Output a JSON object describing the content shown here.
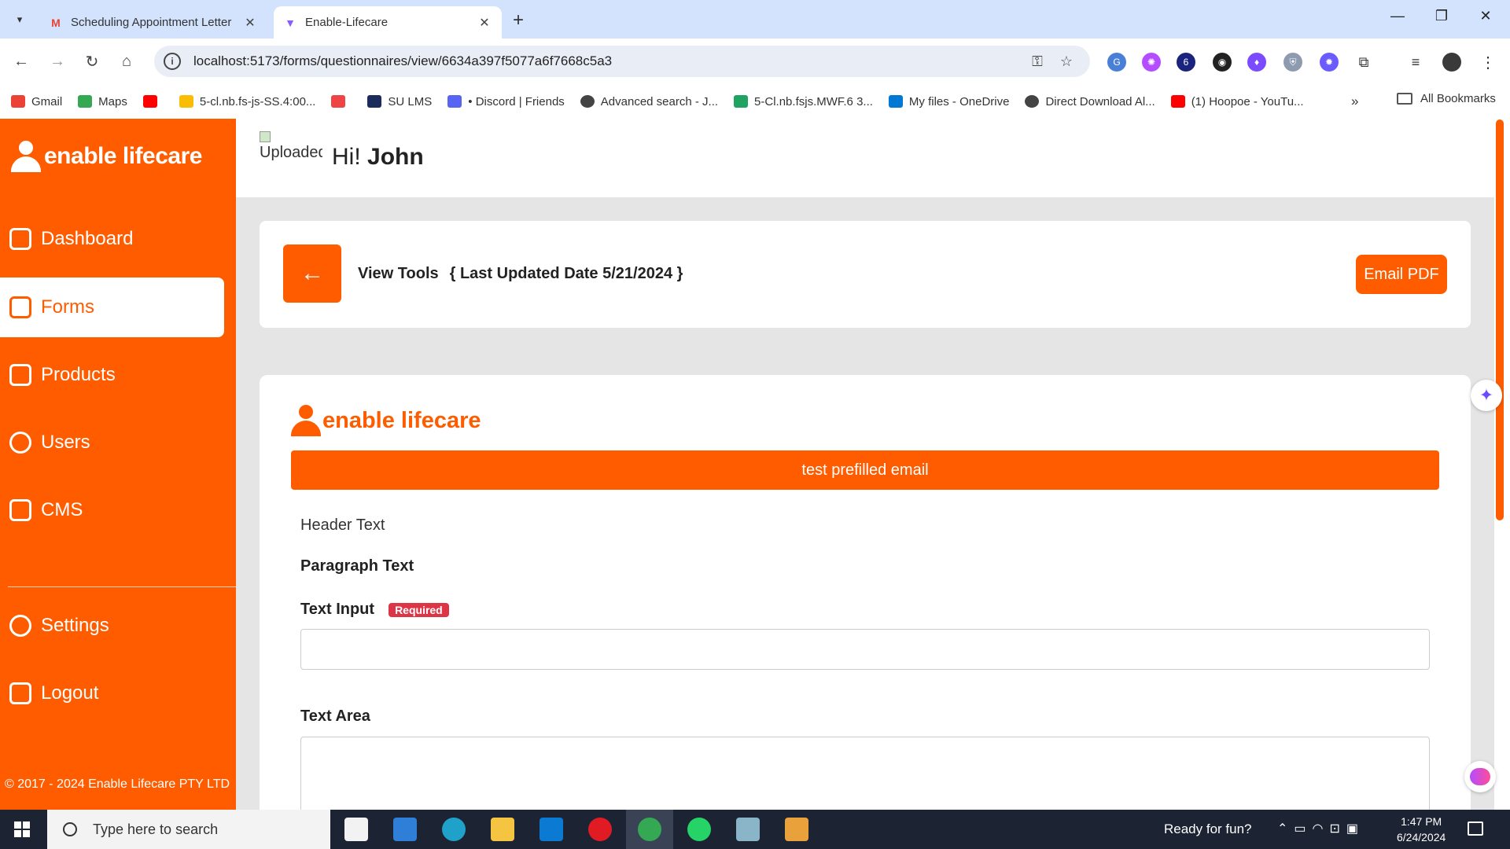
{
  "browser": {
    "tabs": [
      {
        "title": "Scheduling Appointment Letter",
        "icon": "gmail-icon",
        "active": false
      },
      {
        "title": "Enable-Lifecare",
        "icon": "vite-icon",
        "active": true
      }
    ],
    "url": "localhost:5173/forms/questionnaires/view/6634a397f5077a6f7668c5a3",
    "bookmarks": [
      {
        "label": "Gmail",
        "icon": "gmail-icon",
        "color": "#ea4335"
      },
      {
        "label": "Maps",
        "icon": "maps-icon",
        "color": "#34a853"
      },
      {
        "label": "",
        "icon": "youtube-icon",
        "color": "#ff0000"
      },
      {
        "label": "5-cl.nb.fs-js-SS.4:00...",
        "icon": "drive-icon",
        "color": "#fbbc04"
      },
      {
        "label": "",
        "icon": "apps-icon",
        "color": "#e44"
      },
      {
        "label": "SU LMS",
        "icon": "lms-icon",
        "color": "#1a2b5c"
      },
      {
        "label": "• Discord | Friends",
        "icon": "discord-icon",
        "color": "#5865f2"
      },
      {
        "label": "Advanced search - J...",
        "icon": "globe-icon",
        "color": "#444"
      },
      {
        "label": "5-Cl.nb.fsjs.MWF.6 3...",
        "icon": "classroom-icon",
        "color": "#1ea362"
      },
      {
        "label": "My files - OneDrive",
        "icon": "onedrive-icon",
        "color": "#0078d4"
      },
      {
        "label": "Direct Download Al...",
        "icon": "globe-icon",
        "color": "#444"
      },
      {
        "label": "(1) Hoopoe - YouTu...",
        "icon": "youtube-icon",
        "color": "#ff0000"
      }
    ],
    "all_bookmarks": "All Bookmarks"
  },
  "sidebar": {
    "brand": "enable lifecare",
    "items": [
      {
        "label": "Dashboard",
        "icon": "grid-icon",
        "active": false
      },
      {
        "label": "Forms",
        "icon": "forms-icon",
        "active": true
      },
      {
        "label": "Products",
        "icon": "products-icon",
        "active": false
      },
      {
        "label": "Users",
        "icon": "users-icon",
        "active": false
      },
      {
        "label": "CMS",
        "icon": "cms-icon",
        "active": false
      }
    ],
    "bottom_items": [
      {
        "label": "Settings",
        "icon": "settings-icon"
      },
      {
        "label": "Logout",
        "icon": "logout-icon"
      }
    ],
    "copyright": "© 2017 - 2024 Enable Lifecare PTY LTD"
  },
  "header": {
    "avatar_alt": "Uploaded",
    "greeting": "Hi!",
    "user_name": "John"
  },
  "view": {
    "title": "View Tools",
    "updated": "{ Last Updated Date 5/21/2024 }",
    "email_pdf": "Email PDF"
  },
  "form": {
    "brand": "enable lifecare",
    "banner": "test prefilled email",
    "header_text": "Header Text",
    "paragraph_text": "Paragraph Text",
    "text_input_label": "Text Input",
    "required_badge": "Required",
    "text_area_label": "Text Area"
  },
  "taskbar": {
    "search_placeholder": "Type here to search",
    "tray_text": "Ready for fun?",
    "time": "1:47 PM",
    "date": "6/24/2024"
  },
  "colors": {
    "brand": "#ff5c00",
    "required": "#dc3545"
  }
}
